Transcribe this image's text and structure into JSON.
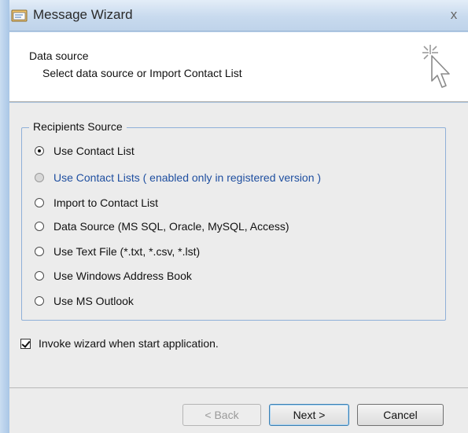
{
  "window": {
    "title": "Message Wizard",
    "close_label": "x"
  },
  "header": {
    "title": "Data source",
    "subtitle": "Select data source or Import Contact List",
    "icon": "wizard-cursor-icon"
  },
  "recipients": {
    "legend": "Recipients Source",
    "options": [
      {
        "label": "Use Contact List",
        "checked": true,
        "enabled": true
      },
      {
        "label": "Use Contact Lists ( enabled only in registered version )",
        "checked": false,
        "enabled": false
      },
      {
        "label": "Import to Contact List",
        "checked": false,
        "enabled": true
      },
      {
        "label": "Data Source (MS SQL, Oracle, MySQL, Access)",
        "checked": false,
        "enabled": true
      },
      {
        "label": "Use Text File  (*.txt, *.csv, *.lst)",
        "checked": false,
        "enabled": true
      },
      {
        "label": "Use Windows Address Book",
        "checked": false,
        "enabled": true
      },
      {
        "label": "Use MS Outlook",
        "checked": false,
        "enabled": true
      }
    ]
  },
  "invoke_checkbox": {
    "label": "Invoke wizard when start application.",
    "checked": true
  },
  "buttons": {
    "back": "< Back",
    "next": "Next >",
    "cancel": "Cancel"
  },
  "colors": {
    "frame": "#b9d1ea",
    "disabled_text": "#1f4fa0",
    "group_border": "#8fb0d8"
  }
}
